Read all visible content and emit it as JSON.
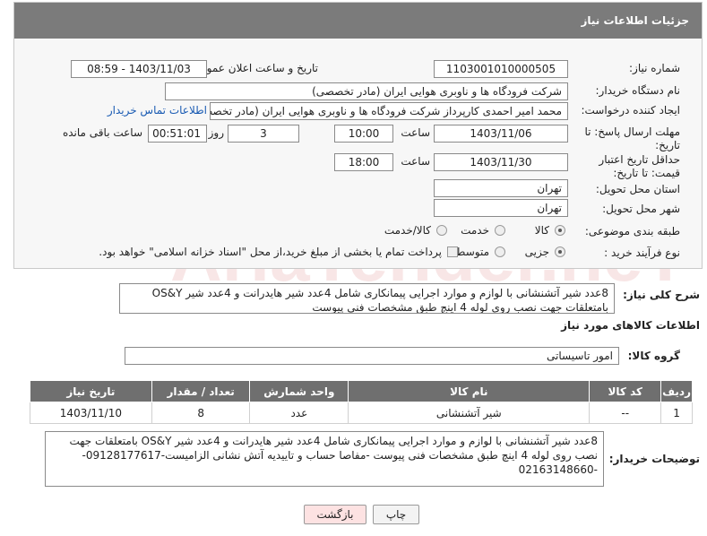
{
  "header": {
    "title": "جزئیات اطلاعات نیاز"
  },
  "need_number": {
    "label": "شماره نیاز:",
    "value": "1103001010000505"
  },
  "announce_datetime": {
    "label": "تاریخ و ساعت اعلان عمومی:",
    "value": "1403/11/03 - 08:59"
  },
  "buyer_org": {
    "label": "نام دستگاه خریدار:",
    "value": "شرکت فرودگاه ها و ناوبری هوایی ایران (مادر تخصصی)"
  },
  "creator": {
    "label": "ایجاد کننده درخواست:",
    "value": "محمد امیر احمدی کارپرداز شرکت فرودگاه ها و ناوبری هوایی ایران (مادر تخصصی)",
    "contact_link": "اطلاعات تماس خریدار"
  },
  "reply_deadline": {
    "label": "مهلت ارسال پاسخ: تا تاریخ:",
    "date": "1403/11/06",
    "time_label": "ساعت",
    "time": "10:00",
    "days": "3",
    "days_label": "روز و",
    "remaining": "00:51:01",
    "remaining_label": "ساعت باقی مانده"
  },
  "price_validity": {
    "label": "حداقل تاریخ اعتبار قیمت: تا تاریخ:",
    "date": "1403/11/30",
    "time_label": "ساعت",
    "time": "18:00"
  },
  "province": {
    "label": "استان محل تحویل:",
    "value": "تهران"
  },
  "city": {
    "label": "شهر محل تحویل:",
    "value": "تهران"
  },
  "category": {
    "label": "طبقه بندی موضوعی:",
    "options": [
      "کالا",
      "خدمت",
      "کالا/خدمت"
    ],
    "selected": "کالا"
  },
  "purchase_type": {
    "label": "نوع فرآیند خرید :",
    "options": [
      "جزیی",
      "متوسط"
    ],
    "selected": "جزیی",
    "note": "پرداخت تمام یا بخشی از مبلغ خرید،از محل \"اسناد خزانه اسلامی\" خواهد بود."
  },
  "description": {
    "label": "شرح کلی نیاز:",
    "value": "8عدد شیر آتشنشانی با لوازم و موارد اجرایی پیمانکاری شامل 4عدد شیر هایدرانت و 4عدد شیر OS&Y بامتعلقات جهت نصب روی لوله 4 اینچ طبق مشخصات فنی پیوست"
  },
  "goods_section": {
    "title": "اطلاعات کالاهای مورد نیاز"
  },
  "goods_group": {
    "label": "گروه کالا:",
    "value": "امور تاسیساتی"
  },
  "table": {
    "headers": [
      "ردیف",
      "کد کالا",
      "نام کالا",
      "واحد شمارش",
      "تعداد / مقدار",
      "تاریخ نیاز"
    ],
    "rows": [
      [
        "1",
        "--",
        "شیر آتشنشانی",
        "عدد",
        "8",
        "1403/11/10"
      ]
    ]
  },
  "buyer_notes": {
    "label": "توضیحات خریدار:",
    "value": "8عدد شیر آتشنشانی با لوازم و موارد اجرایی پیمانکاری شامل 4عدد شیر هایدرانت و 4عدد شیر OS&Y بامتعلقات جهت نصب روی لوله 4 اینچ طبق مشخصات فنی پیوست -مفاصا حساب و تاییدیه آتش نشانی الزامیست-09128177617--02163148660"
  },
  "buttons": {
    "print": "چاپ",
    "back": "بازگشت"
  },
  "watermark": "AriaTender.neT"
}
